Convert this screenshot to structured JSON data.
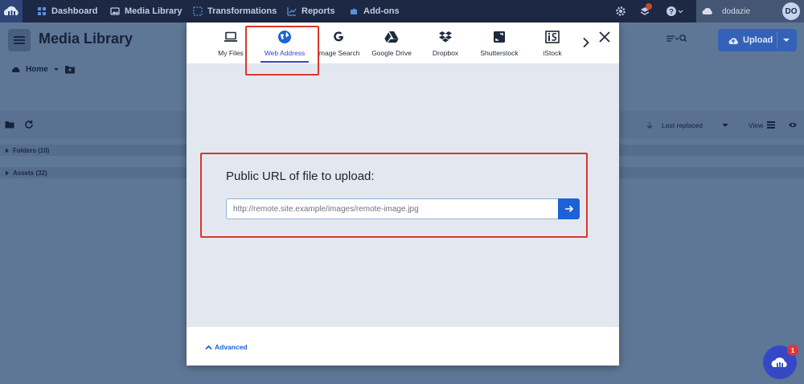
{
  "topnav": {
    "items": [
      {
        "label": "Dashboard",
        "icon": "grid-icon"
      },
      {
        "label": "Media Library",
        "icon": "image-icon"
      },
      {
        "label": "Transformations",
        "icon": "transform-icon"
      },
      {
        "label": "Reports",
        "icon": "chart-icon"
      },
      {
        "label": "Add-ons",
        "icon": "puzzle-icon"
      }
    ],
    "user_name": "dodazie",
    "avatar_initials": "DO"
  },
  "page": {
    "title": "Media Library",
    "breadcrumb_home": "Home",
    "upload_label": "Upload",
    "sort_label": "Last replaced",
    "view_label": "View",
    "folders_label": "Folders (10)",
    "assets_label": "Assets (32)"
  },
  "modal": {
    "tabs": [
      {
        "label": "My Files",
        "icon": "laptop-icon"
      },
      {
        "label": "Web Address",
        "icon": "globe-icon"
      },
      {
        "label": "Image Search",
        "icon": "google-icon"
      },
      {
        "label": "Google Drive",
        "icon": "drive-icon"
      },
      {
        "label": "Dropbox",
        "icon": "dropbox-icon"
      },
      {
        "label": "Shutterstock",
        "icon": "shutterstock-icon"
      },
      {
        "label": "iStock",
        "icon": "istock-icon"
      }
    ],
    "active_tab": "Web Address",
    "url_prompt": "Public URL of file to upload:",
    "url_placeholder": "http://remote.site.example/images/remote-image.jpg",
    "advanced_label": "Advanced"
  },
  "fab_badge": "1",
  "colors": {
    "accent": "#3448c5",
    "button_blue": "#1c62d6",
    "highlight_red": "#d9362b",
    "nav_bg": "#1c2844"
  }
}
